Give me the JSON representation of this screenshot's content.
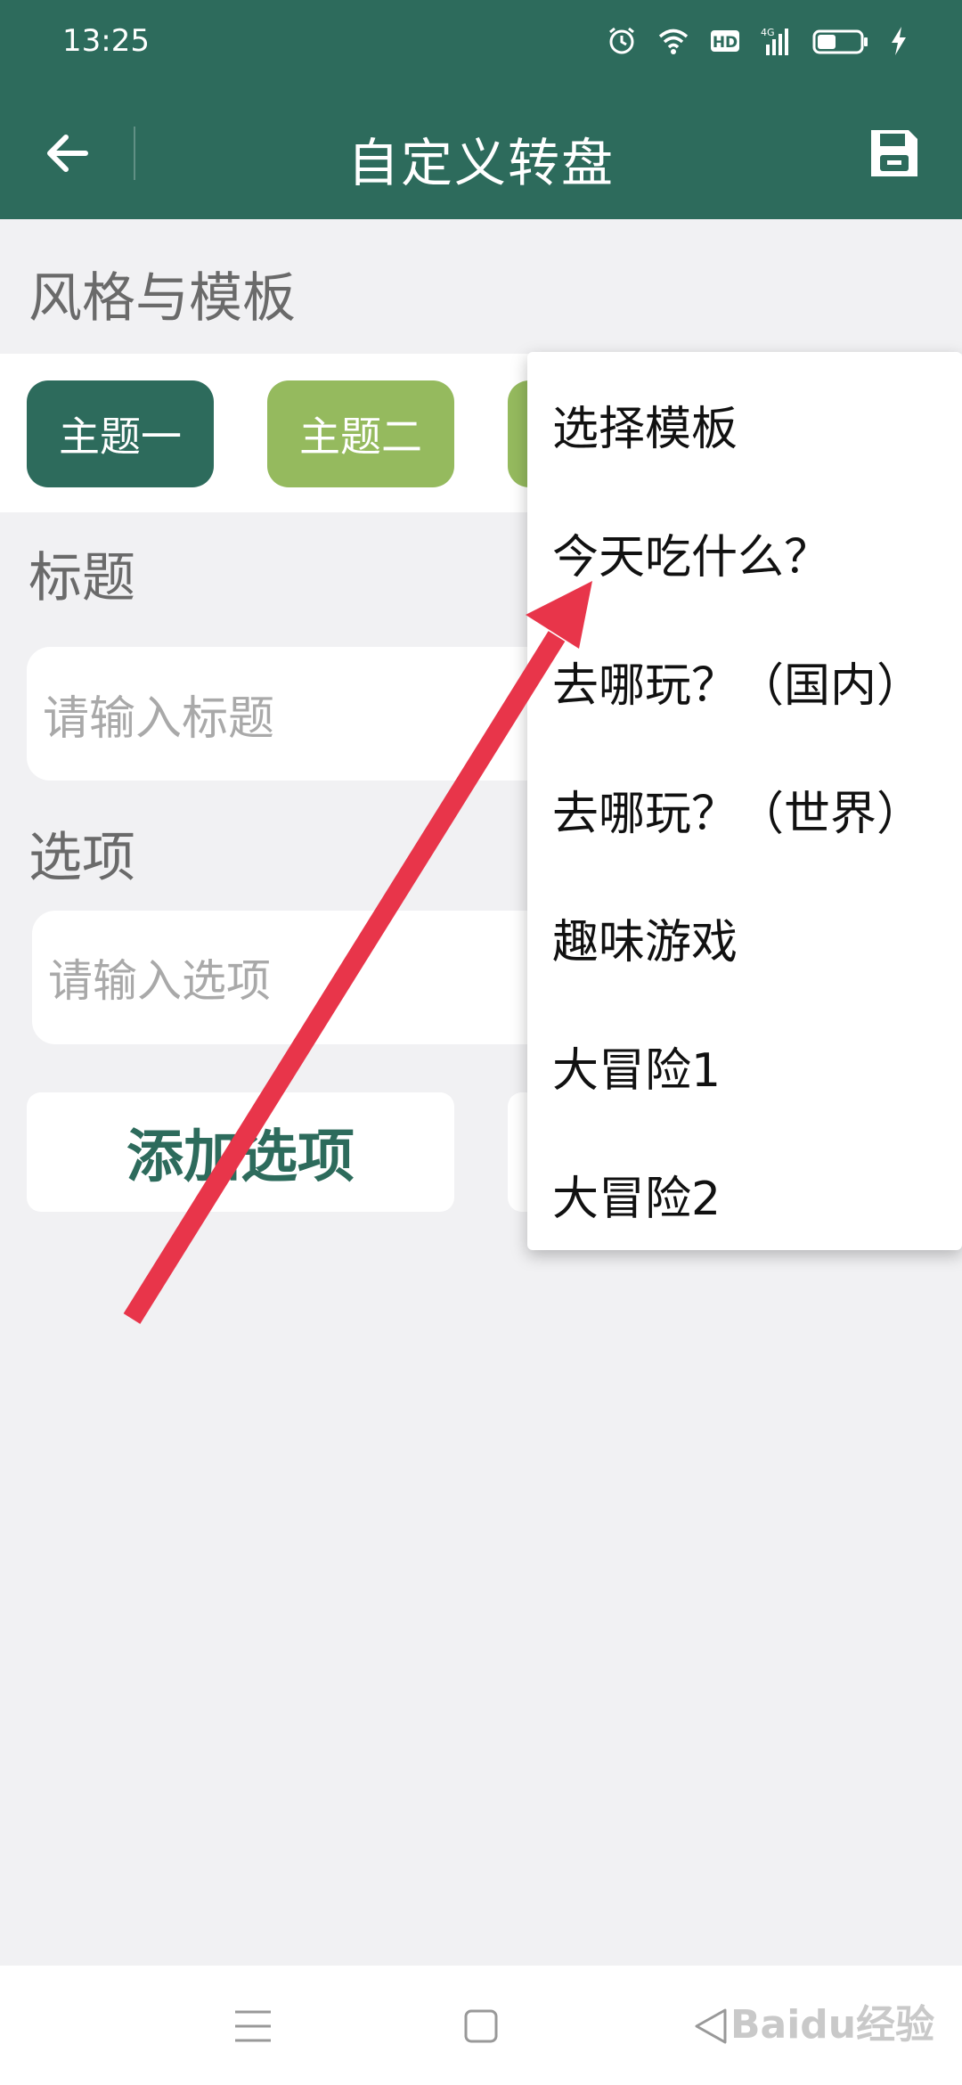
{
  "status_bar": {
    "time": "13:25",
    "icons": [
      "alarm-icon",
      "wifi-icon",
      "hd-icon",
      "signal-4g-icon",
      "battery-icon",
      "charging-icon"
    ],
    "hd_label": "HD",
    "signal_label": "4G"
  },
  "app_bar": {
    "title": "自定义转盘",
    "back_icon": "back-arrow-icon",
    "save_icon": "save-icon"
  },
  "style_section": {
    "title": "风格与模板",
    "themes": [
      {
        "label": "主题一"
      },
      {
        "label": "主题二"
      },
      {
        "label": ""
      }
    ]
  },
  "title_section": {
    "title": "标题",
    "input_placeholder": "请输入标题"
  },
  "options_section": {
    "title": "选项",
    "input_placeholder": "请输入选项",
    "add_button": "添加选项"
  },
  "template_menu": {
    "items": [
      {
        "label": "选择模板"
      },
      {
        "label": "今天吃什么？"
      },
      {
        "label": "去哪玩？（国内）"
      },
      {
        "label": "去哪玩？（世界）"
      },
      {
        "label": "趣味游戏"
      },
      {
        "label": "大冒险1"
      },
      {
        "label": "大冒险2"
      }
    ]
  },
  "annotation": {
    "arrow_color": "#e8354a"
  },
  "colors": {
    "primary": "#2d6b5c",
    "secondary": "#95ba5e",
    "background": "#f1f1f3"
  },
  "nav_bar": {
    "icons": [
      "menu-icon",
      "home-icon",
      "back-icon"
    ]
  },
  "watermark": {
    "text": "Baidu经验"
  }
}
